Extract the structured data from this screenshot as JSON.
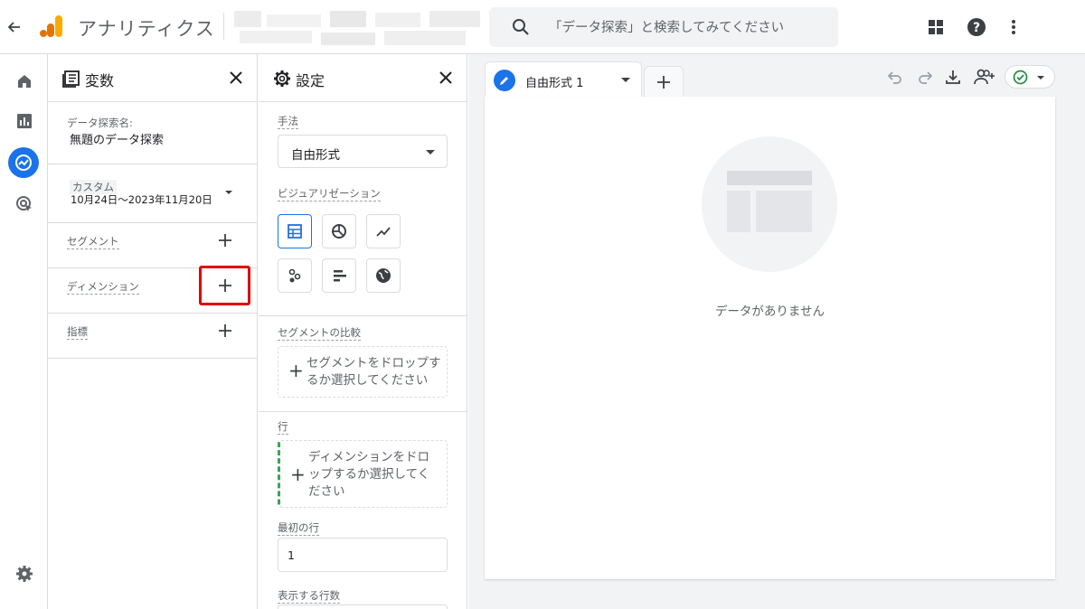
{
  "topbar": {
    "app_title": "アナリティクス",
    "search_placeholder": "「データ探索」と検索してみてください"
  },
  "variables_panel": {
    "title": "変数",
    "exploration_name_label": "データ探索名:",
    "exploration_name_value": "無題のデータ探索",
    "date_label": "カスタム",
    "date_range": "10月24日～2023年11月20日",
    "segments_label": "セグメント",
    "dimensions_label": "ディメンション",
    "metrics_label": "指標"
  },
  "settings_panel": {
    "title": "設定",
    "technique_label": "手法",
    "technique_value": "自由形式",
    "visualization_label": "ビジュアリゼーション",
    "segment_compare_label": "セグメントの比較",
    "segment_drop_line1": "セグメントをドロップす",
    "segment_drop_line2": "るか選択してください",
    "rows_label": "行",
    "rows_drop_line1": "ディメンションをドロ",
    "rows_drop_line2": "ップするか選択してく",
    "rows_drop_line3": "ださい",
    "first_row_label": "最初の行",
    "first_row_value": "1",
    "rows_to_show_label": "表示する行数"
  },
  "canvas": {
    "tab_label": "自由形式 1",
    "empty_message": "データがありません"
  },
  "colors": {
    "accent": "#1a73e8",
    "highlight": "#e00000",
    "logo_orange": "#f9ab00",
    "logo_dark": "#e37400",
    "green": "#1e8e3e"
  }
}
